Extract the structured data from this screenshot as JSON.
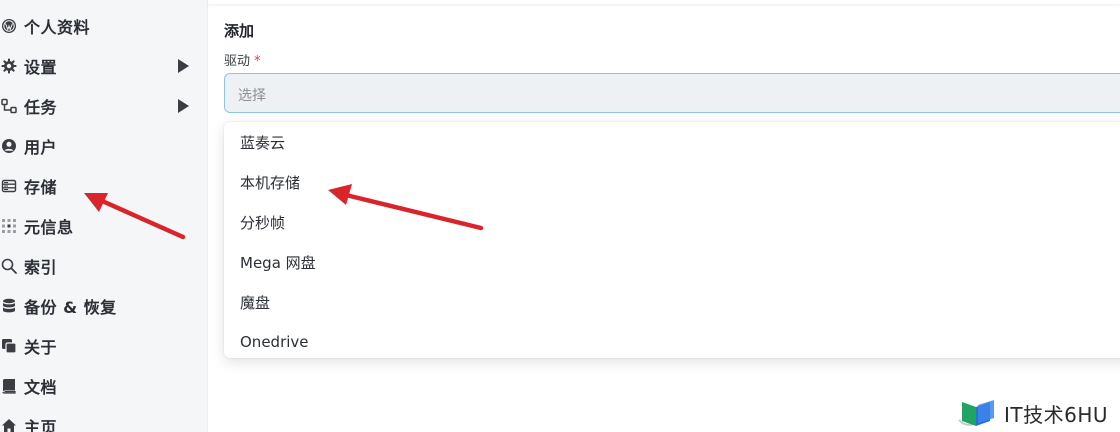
{
  "sidebar": {
    "items": [
      {
        "label": "个人资料",
        "icon": "wordpress-icon"
      },
      {
        "label": "设置",
        "icon": "gear-icon",
        "has_submenu": true
      },
      {
        "label": "任务",
        "icon": "flow-icon",
        "has_submenu": true
      },
      {
        "label": "用户",
        "icon": "user-circle-icon"
      },
      {
        "label": "存储",
        "icon": "storage-icon"
      },
      {
        "label": "元信息",
        "icon": "grid-icon"
      },
      {
        "label": "索引",
        "icon": "search-icon"
      },
      {
        "label": "备份 & 恢复",
        "icon": "database-icon"
      },
      {
        "label": "关于",
        "icon": "copy-icon"
      },
      {
        "label": "文档",
        "icon": "book-icon"
      },
      {
        "label": "主页",
        "icon": "home-icon"
      }
    ]
  },
  "main": {
    "title": "添加",
    "driver_field": {
      "label": "驱动",
      "required_mark": "*",
      "placeholder": "选择"
    },
    "dropdown_options": [
      "蓝奏云",
      "本机存储",
      "分秒帧",
      "Mega 网盘",
      "魔盘",
      "Onedrive"
    ]
  },
  "watermark": {
    "text": "IT技术6HU"
  },
  "colors": {
    "sidebar_bg": "#f5f6f8",
    "select_border": "#8fc3e8",
    "select_bg": "#eef1f3",
    "arrow": "#d9242b",
    "required": "#e0393e"
  }
}
